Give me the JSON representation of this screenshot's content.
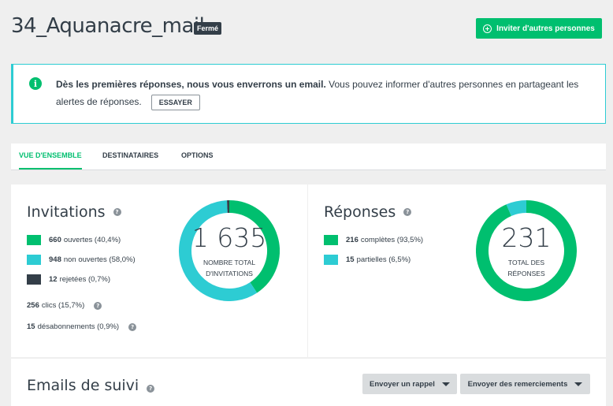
{
  "header": {
    "title": "34_Aquanacre_mail",
    "status_badge": "Fermé",
    "invite_button": "Inviter d'autres personnes"
  },
  "alert": {
    "bold_text": "Dès les premières réponses, nous vous enverrons un email.",
    "text": " Vous pouvez informer d'autres personnes en partageant les alertes de réponses.",
    "button": "ESSAYER"
  },
  "tabs": [
    {
      "label": "VUE D'ENSEMBLE",
      "active": true
    },
    {
      "label": "DESTINATAIRES",
      "active": false
    },
    {
      "label": "OPTIONS",
      "active": false
    }
  ],
  "invitations": {
    "title": "Invitations",
    "legend": [
      {
        "count": "660",
        "label": "ouvertes (40,4%)",
        "color": "#00bf6f"
      },
      {
        "count": "948",
        "label": "non ouvertes (58,0%)",
        "color": "#2dccd3"
      },
      {
        "count": "12",
        "label": "rejetées (0,7%)",
        "color": "#333e48"
      }
    ],
    "clicks": {
      "count": "256",
      "label": "clics (15,7%)"
    },
    "unsubscribes": {
      "count": "15",
      "label": "désabonnements (0,9%)"
    },
    "total": "1 635",
    "total_label_1": "NOMBRE TOTAL",
    "total_label_2": "D'INVITATIONS",
    "chart_values": [
      660,
      948,
      12
    ]
  },
  "responses": {
    "title": "Réponses",
    "legend": [
      {
        "count": "216",
        "label": "complètes (93,5%)",
        "color": "#00bf6f"
      },
      {
        "count": "15",
        "label": "partielles (6,5%)",
        "color": "#2dccd3"
      }
    ],
    "total": "231",
    "total_label_1": "TOTAL DES",
    "total_label_2": "RÉPONSES",
    "chart_values": [
      216,
      15
    ]
  },
  "followup": {
    "title": "Emails de suivi",
    "reminder_button": "Envoyer un rappel",
    "thanks_button": "Envoyer des remerciements"
  },
  "colors": {
    "green": "#00bf6f",
    "teal": "#2dccd3",
    "dark": "#333e48"
  }
}
